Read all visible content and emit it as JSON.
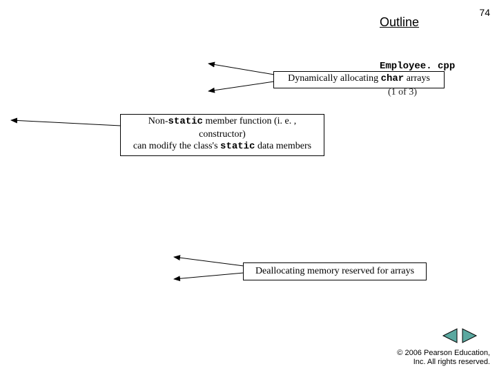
{
  "header": {
    "outline": "Outline",
    "page_number": "74"
  },
  "filename": "Employee. cpp",
  "partial_text": "(1 of 3)",
  "callouts": {
    "c1": {
      "prefix": "Dynamically allocating ",
      "mono": "char",
      "suffix": " arrays"
    },
    "c2": {
      "line1_prefix": "Non-",
      "line1_mono": "static",
      "line1_suffix": " member function (i. e. , constructor)",
      "line2_prefix": "can modify the class's ",
      "line2_mono": "static",
      "line2_suffix": " data members"
    },
    "c3": "Deallocating memory reserved for arrays"
  },
  "footer": {
    "copyright_line1": "© 2006 Pearson Education,",
    "copyright_line2": "Inc.  All rights reserved."
  },
  "nav": {
    "prev": "previous",
    "next": "next"
  }
}
